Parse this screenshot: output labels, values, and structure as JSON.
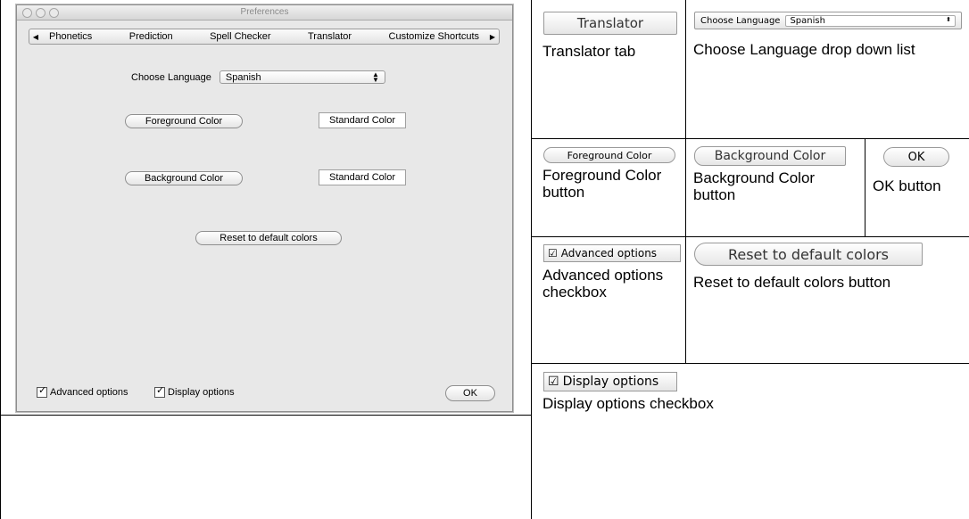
{
  "window": {
    "title": "Preferences",
    "tabs": [
      "Phonetics",
      "Prediction",
      "Spell Checker",
      "Translator",
      "Customize Shortcuts"
    ],
    "language_label": "Choose Language",
    "language_value": "Spanish",
    "foreground_button": "Foreground Color",
    "foreground_swatch": "Standard Color",
    "background_button": "Background Color",
    "background_swatch": "Standard Color",
    "reset_button": "Reset to default colors",
    "advanced_checkbox": "Advanced options",
    "display_checkbox": "Display options",
    "ok_button": "OK"
  },
  "legend": {
    "translator_img": "Translator",
    "translator_caption": "Translator tab",
    "lang_img_label": "Choose Language",
    "lang_img_value": "Spanish",
    "lang_caption": "Choose Language drop down list",
    "fg_img": "Foreground Color",
    "fg_caption": "Foreground Color button",
    "bg_img": "Background Color",
    "bg_caption": "Background Color button",
    "ok_img": "OK",
    "ok_caption": "OK button",
    "adv_img": "Advanced options",
    "adv_caption": "Advanced options checkbox",
    "reset_img": "Reset to default colors",
    "reset_caption": "Reset to default colors button",
    "disp_img": "Display options",
    "disp_caption": "Display options checkbox"
  }
}
